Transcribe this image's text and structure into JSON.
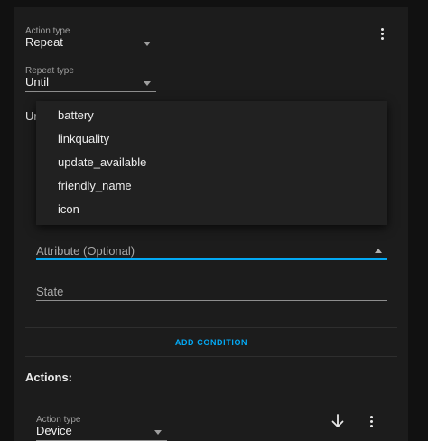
{
  "action1": {
    "action_type": {
      "label": "Action type",
      "value": "Repeat"
    },
    "repeat_type": {
      "label": "Repeat type",
      "value": "Until"
    },
    "clipped_label": "Ur",
    "options_icon": "more-vertical-icon"
  },
  "attribute_menu": {
    "items": [
      "battery",
      "linkquality",
      "update_available",
      "friendly_name",
      "icon"
    ]
  },
  "condition": {
    "attribute_placeholder": "Attribute (Optional)",
    "state_placeholder": "State"
  },
  "add_condition_label": "ADD CONDITION",
  "actions_heading": "Actions:",
  "action2": {
    "action_type": {
      "label": "Action type",
      "value": "Device"
    },
    "move_down_icon": "arrow-down-icon",
    "options_icon": "more-vertical-icon"
  },
  "colors": {
    "accent": "#03a9f4",
    "background": "#111111",
    "card": "#1c1c1c",
    "menu": "#212121"
  }
}
